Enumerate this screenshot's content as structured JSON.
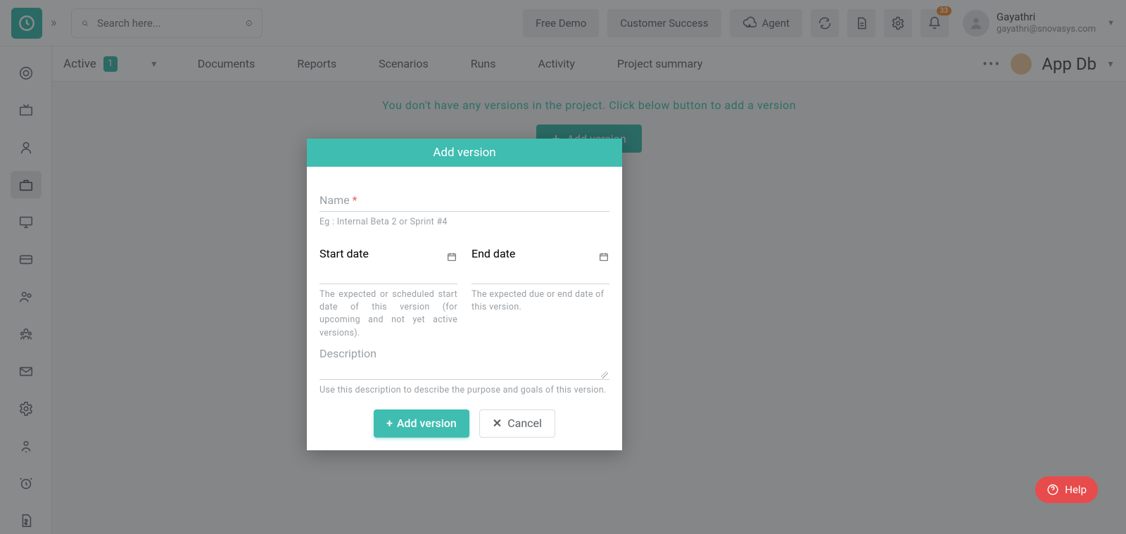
{
  "search": {
    "placeholder": "Search here..."
  },
  "top_actions": {
    "free_demo": "Free Demo",
    "customer_success": "Customer Success",
    "agent": "Agent"
  },
  "notifications_count": "33",
  "user": {
    "name": "Gayathri",
    "email": "gayathri@snovasys.com"
  },
  "status_filter": {
    "label": "Active",
    "count": "1"
  },
  "tabs": {
    "documents": "Documents",
    "reports": "Reports",
    "scenarios": "Scenarios",
    "runs": "Runs",
    "activity": "Activity",
    "project_summary": "Project summary"
  },
  "project_name": "App Db",
  "empty_state": {
    "text": "You don't have any versions in the project. Click below button to add a version",
    "button": "Add version"
  },
  "modal": {
    "title": "Add version",
    "name_label": "Name",
    "name_hint": "Eg : Internal Beta 2 or Sprint #4",
    "start_label": "Start date",
    "start_hint": "The expected or scheduled start date of this version (for upcoming and not yet active versions).",
    "end_label": "End date",
    "end_hint": "The expected due or end date of this version.",
    "desc_label": "Description",
    "desc_hint": "Use this description to describe the purpose and goals of this version.",
    "submit": "Add version",
    "cancel": "Cancel"
  },
  "help_label": "Help"
}
